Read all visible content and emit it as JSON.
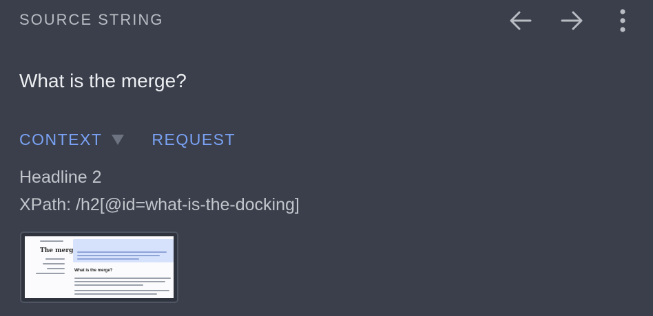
{
  "header": {
    "title": "SOURCE STRING",
    "actions": [
      {
        "icon": "arrow-left-icon"
      },
      {
        "icon": "arrow-right-icon"
      },
      {
        "icon": "more-vertical-icon"
      }
    ]
  },
  "source": {
    "text": "What is the merge?"
  },
  "tabs": [
    {
      "label": "CONTEXT",
      "has_dropdown": true
    },
    {
      "label": "REQUEST",
      "has_dropdown": false
    }
  ],
  "context": {
    "kind": "Headline 2",
    "xpath": "XPath: /h2[@id=what-is-the-docking]"
  },
  "screenshot_thumbnail": {
    "nav_title": "The merge",
    "heading": "What is the merge?"
  },
  "colors": {
    "background": "#3a3f4b",
    "accent": "#7aa2f5",
    "icon": "#b9bcc3"
  }
}
